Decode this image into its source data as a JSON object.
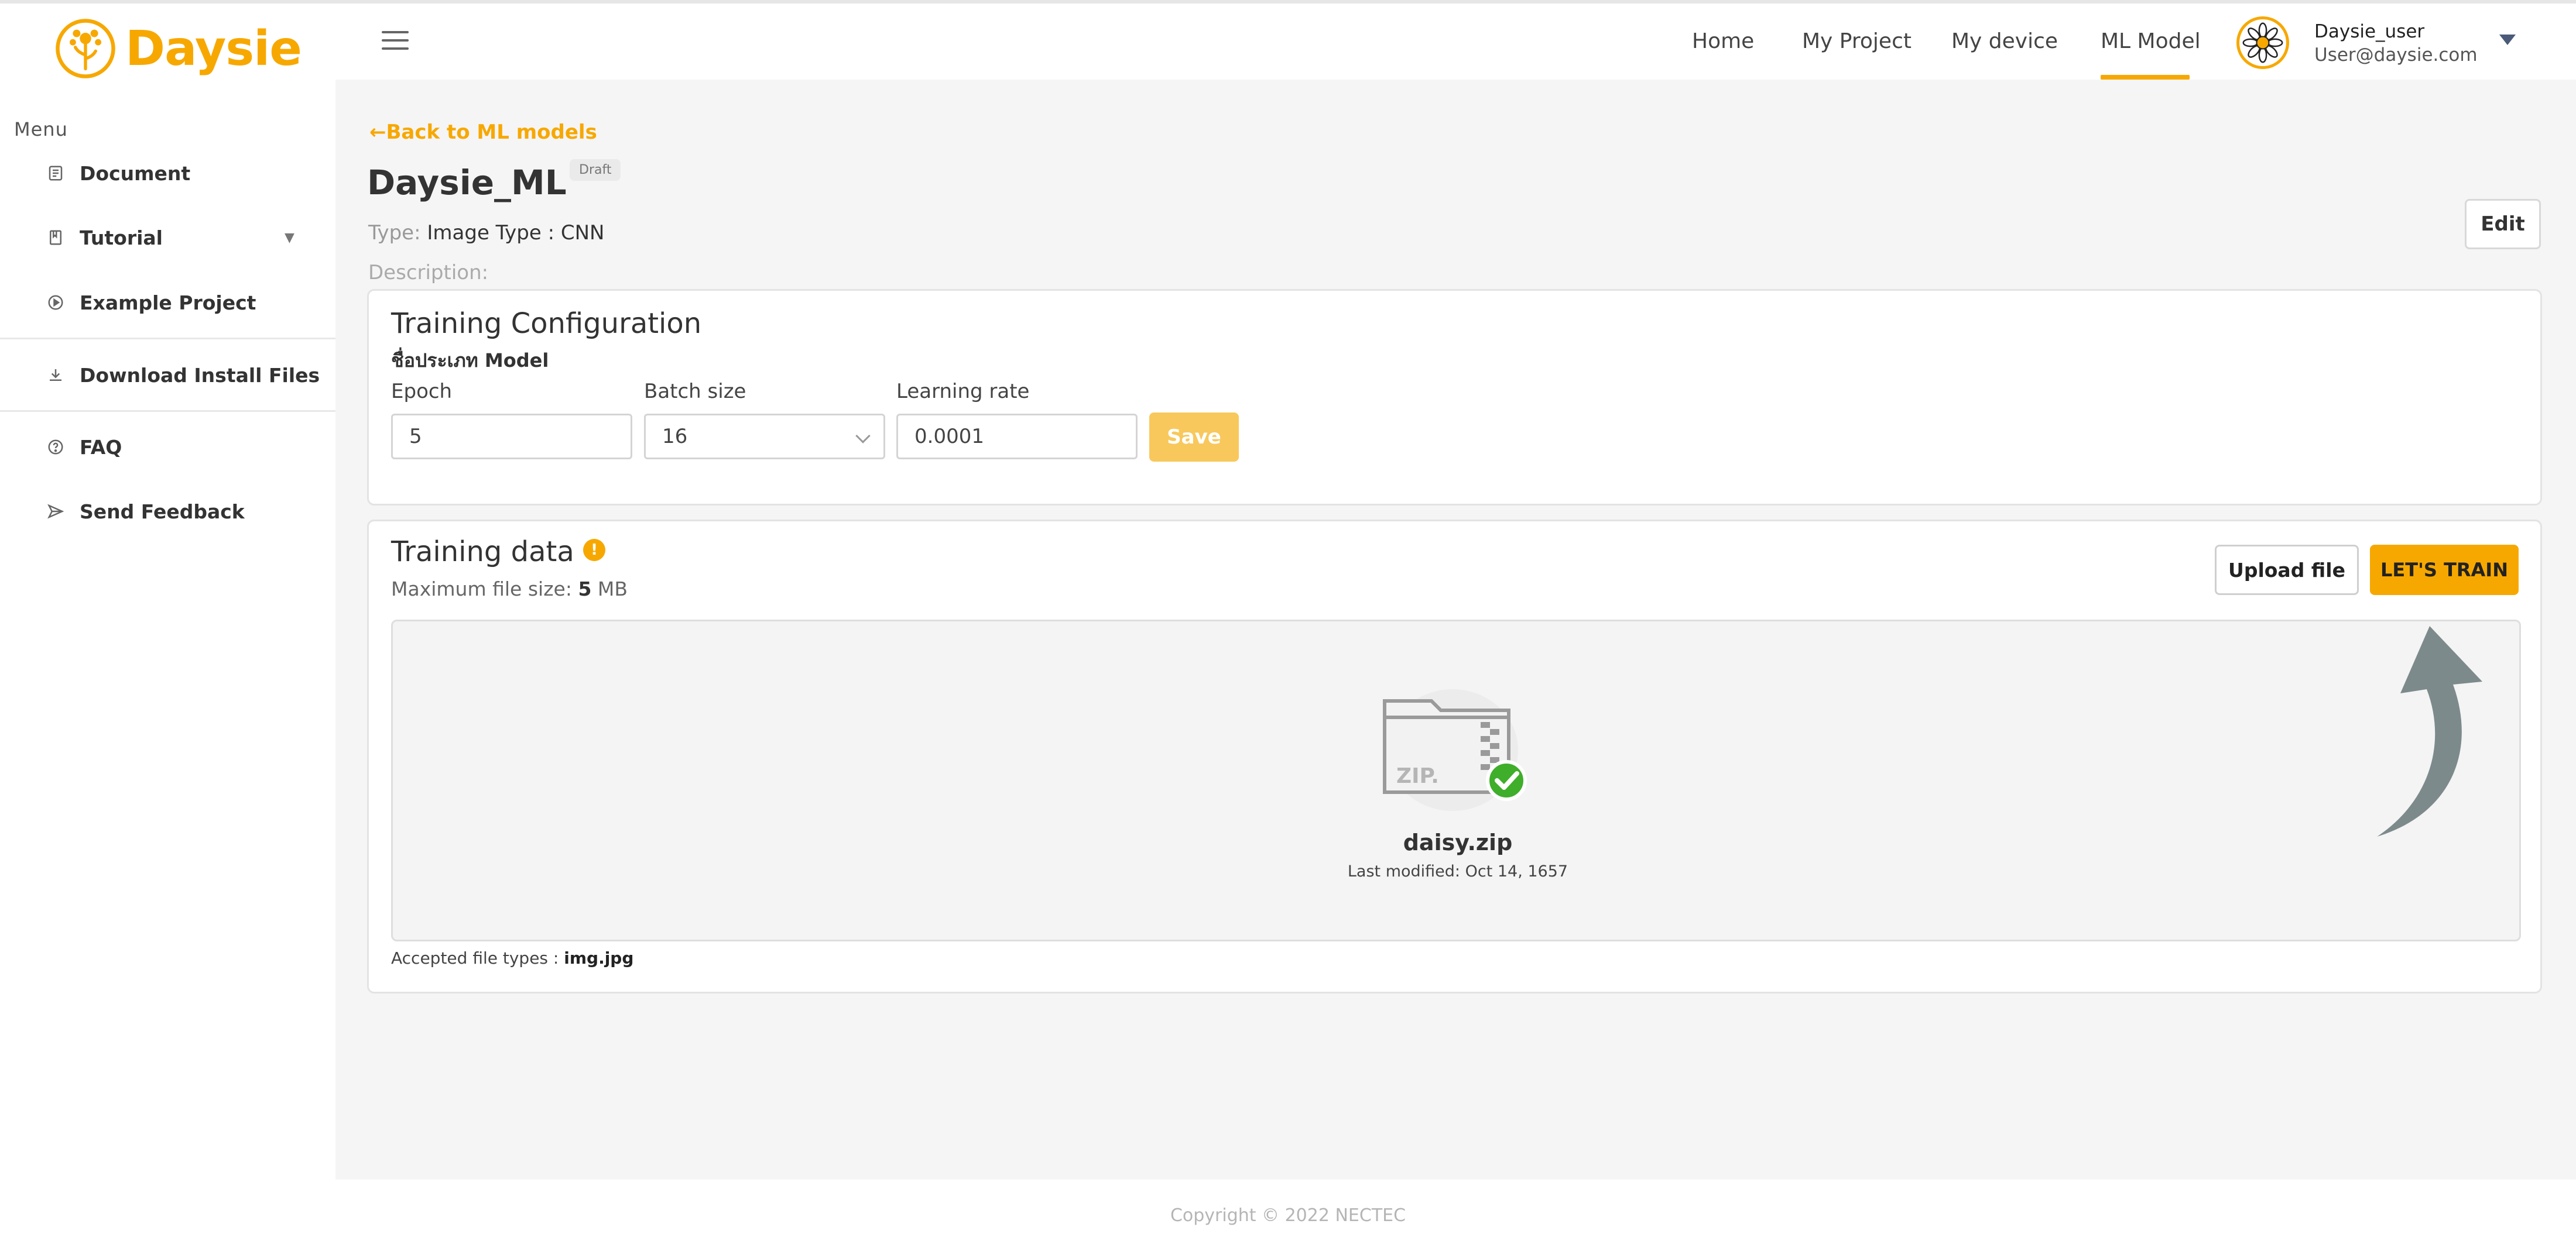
{
  "brand": {
    "name": "Daysie",
    "color": "#f7a800"
  },
  "sidebar": {
    "menu_label": "Menu",
    "items": [
      {
        "label": "Document",
        "icon": "document-icon"
      },
      {
        "label": "Tutorial",
        "icon": "book-icon",
        "has_caret": true
      },
      {
        "label": "Example Project",
        "icon": "play-circle-icon"
      },
      {
        "label": "Download Install Files",
        "icon": "download-icon"
      },
      {
        "label": "FAQ",
        "icon": "help-circle-icon"
      },
      {
        "label": "Send Feedback",
        "icon": "send-icon"
      }
    ]
  },
  "header": {
    "nav": [
      "Home",
      "My Project",
      "My device",
      "ML Model"
    ],
    "active_nav": "ML Model",
    "user": {
      "name": "Daysie_user",
      "email": "User@daysie.com"
    }
  },
  "page": {
    "back_link": "Back to ML models",
    "title": "Daysie_ML",
    "badge": "Draft",
    "type_key": "Type:",
    "type_value": "Image Type : CNN",
    "description_key": "Description:",
    "edit_label": "Edit"
  },
  "training_config": {
    "title": "Training Configuration",
    "subtitle": "ชื่อประเภท Model",
    "epoch_label": "Epoch",
    "epoch_value": "5",
    "batch_label": "Batch size",
    "batch_value": "16",
    "lr_label": "Learning rate",
    "lr_value": "0.0001",
    "save_label": "Save"
  },
  "training_data": {
    "title": "Training data",
    "info_glyph": "!",
    "max_size_prefix": "Maximum file size:",
    "max_size_value": "5",
    "max_size_unit": "MB",
    "upload_label": "Upload file",
    "train_label": "LET'S TRAIN",
    "file": {
      "zip_text": "ZIP.",
      "name": "daisy.zip",
      "modified": "Last modified: Oct 14, 1657"
    },
    "accepted_prefix": "Accepted file types :",
    "accepted_value": "img.jpg"
  },
  "footer": {
    "copyright": "Copyright © 2022 NECTEC"
  }
}
